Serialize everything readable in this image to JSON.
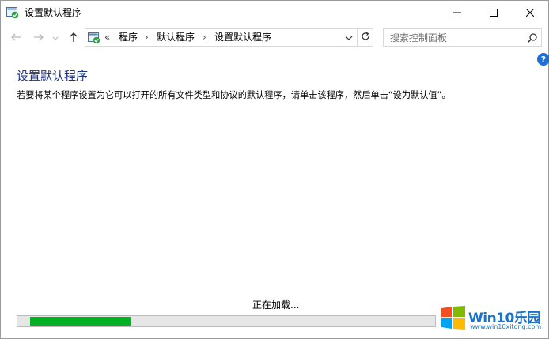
{
  "window": {
    "title": "设置默认程序"
  },
  "titlebar": {
    "minimize_icon": "minimize-icon",
    "maximize_icon": "maximize-icon",
    "close_icon": "close-icon"
  },
  "nav": {
    "back_icon": "arrow-left-icon",
    "forward_icon": "arrow-right-icon",
    "recent_icon": "chevron-down-icon",
    "up_icon": "arrow-up-icon"
  },
  "address": {
    "overflow_label": "«",
    "breadcrumbs": [
      "程序",
      "默认程序",
      "设置默认程序"
    ],
    "separator": "›"
  },
  "search": {
    "placeholder": "搜索控制面板"
  },
  "help": {
    "label": "?"
  },
  "main": {
    "title": "设置默认程序",
    "description": "若要将某个程序设置为它可以打开的所有文件类型和协议的默认程序，请单击该程序，然后单击“设为默认值”。"
  },
  "loading": {
    "text": "正在加载...",
    "progress_fraction": 0.24
  },
  "watermark": {
    "brand": "Win10乐园",
    "url": "www.win10xitong.com"
  },
  "colors": {
    "title_blue": "#1e3287",
    "progress_green": "#06b025",
    "help_blue": "#1e6fd9"
  }
}
